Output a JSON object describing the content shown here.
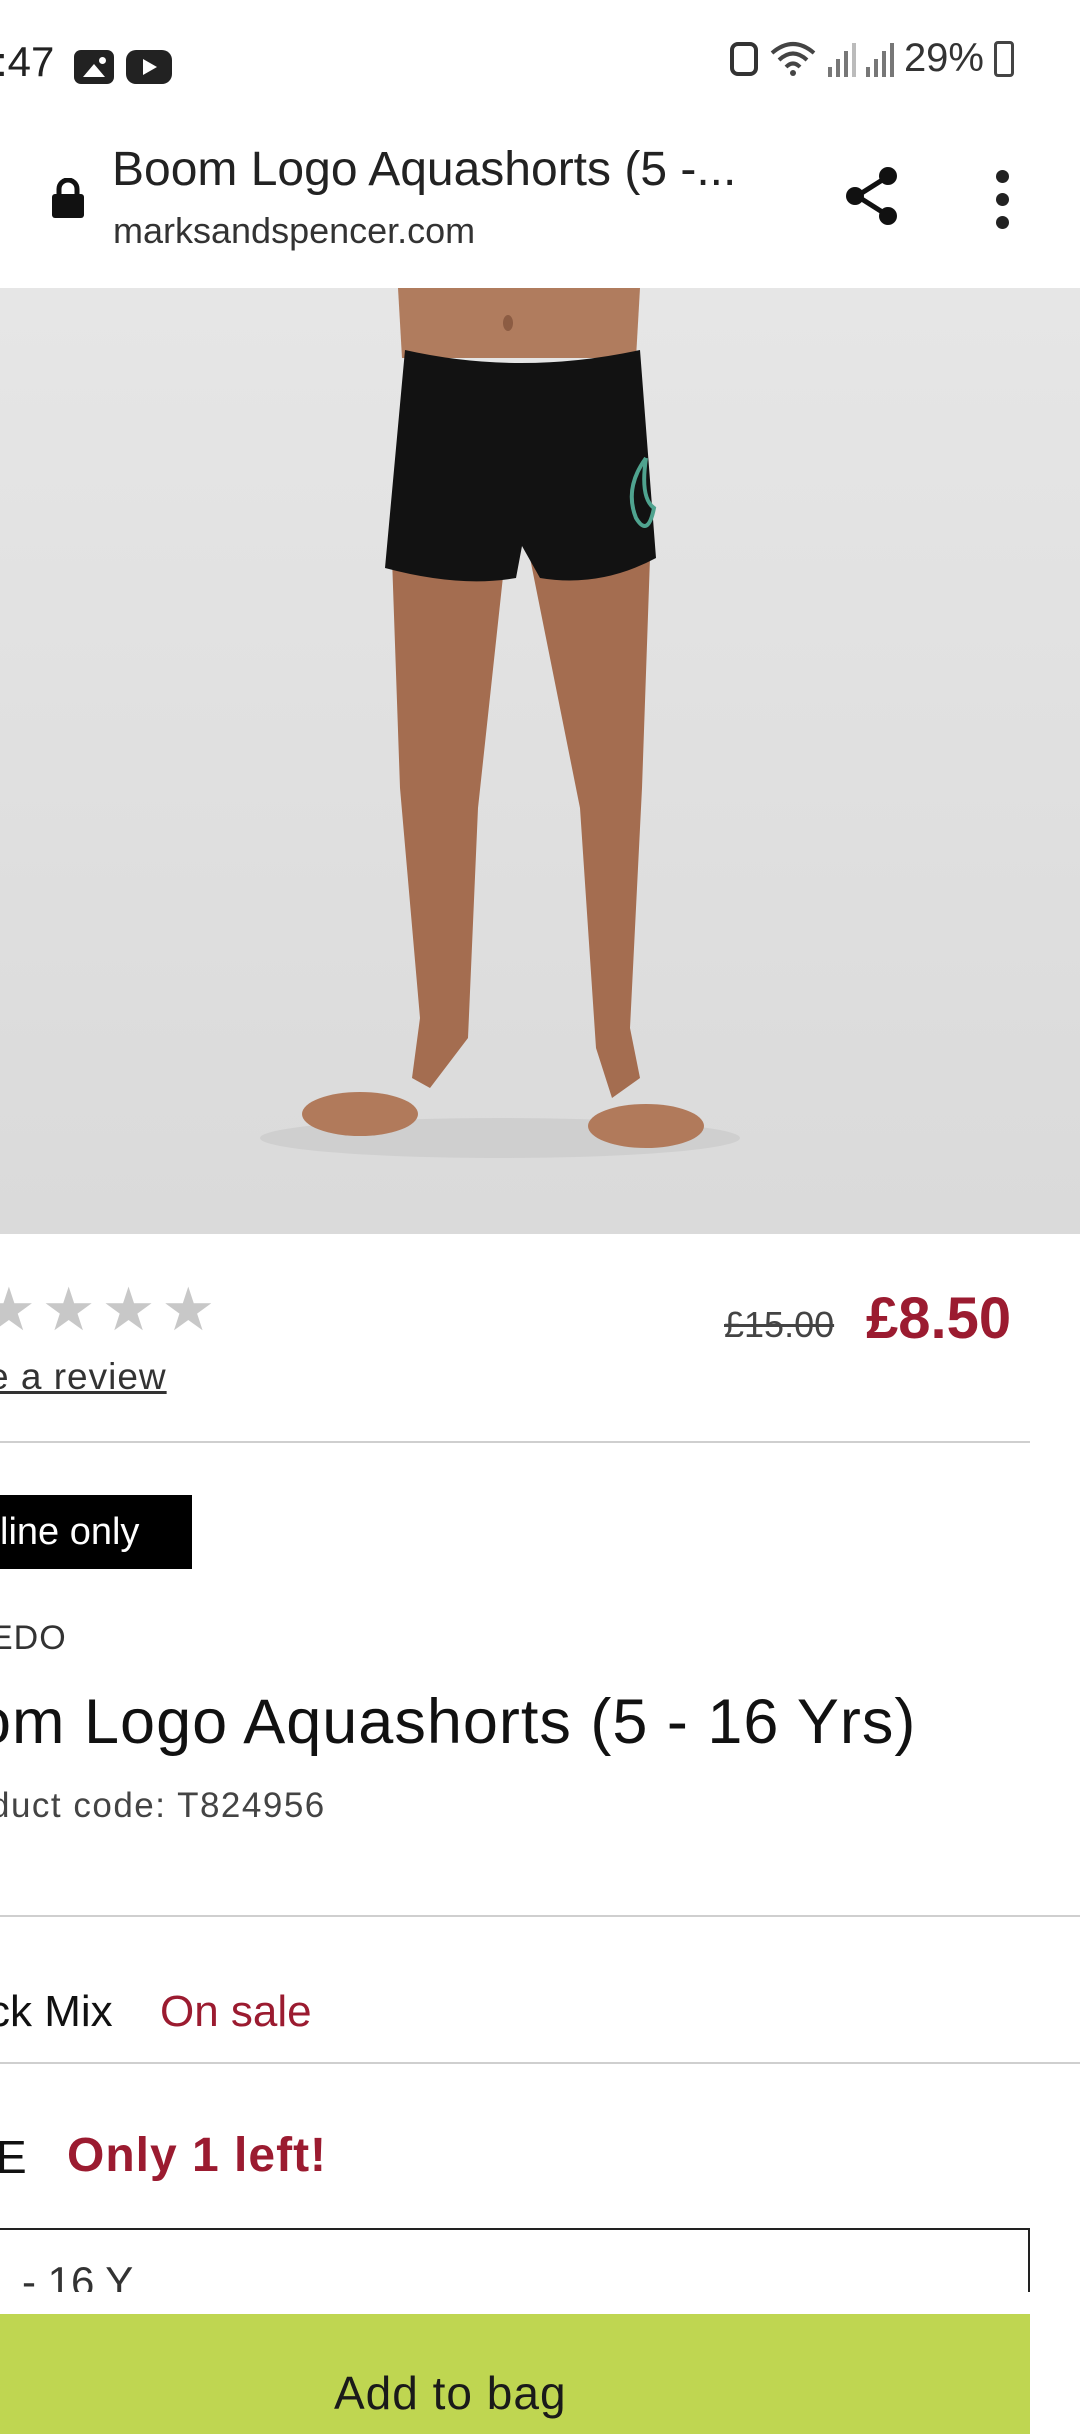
{
  "status_bar": {
    "time": ":47",
    "battery": "29%"
  },
  "browser": {
    "page_title": "Boom Logo Aquashorts (5 -...",
    "domain": "marksandspencer.com"
  },
  "product": {
    "rating_stars": 4,
    "review_link": "e a review",
    "old_price": "£15.00",
    "new_price": "£8.50",
    "badge": "line only",
    "brand": "EDO",
    "name": "om Logo Aquashorts (5 - 16 Yrs)",
    "code": "duct code: T824956",
    "colour": "ck Mix",
    "colour_sale_label": "On sale",
    "size_label": "E",
    "stock_note": "Only 1 left!",
    "size_select_value": "- 16 Y",
    "add_to_bag": "Add to bag"
  },
  "colors": {
    "price_red": "#9b1b30",
    "add_to_bag_green": "#bfd651"
  }
}
